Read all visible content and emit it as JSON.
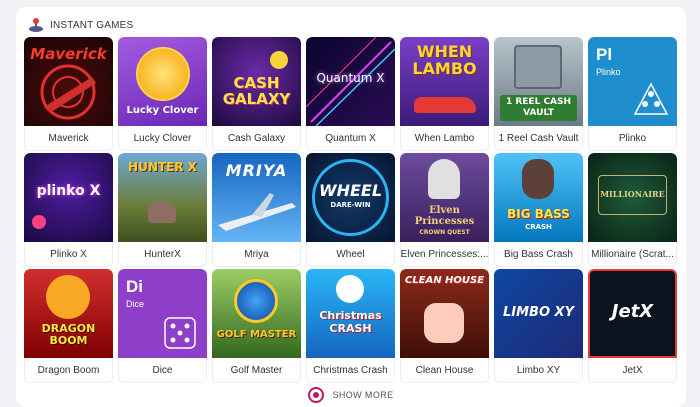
{
  "section": {
    "title": "INSTANT GAMES",
    "icon": "joystick-icon"
  },
  "games": [
    {
      "name": "Maverick",
      "art": "Maverick"
    },
    {
      "name": "Lucky Clover",
      "art": "Lucky Clover"
    },
    {
      "name": "Cash Galaxy",
      "art": "CASH GALAXY"
    },
    {
      "name": "Quantum X",
      "art": "Quantum X"
    },
    {
      "name": "When Lambo",
      "art": "WHEN LAMBO"
    },
    {
      "name": "1 Reel Cash Vault",
      "art": "1 REEL CASH VAULT"
    },
    {
      "name": "Plinko",
      "art": "Pl",
      "art2": "Plinko"
    },
    {
      "name": "Plinko X",
      "art": "plinko X"
    },
    {
      "name": "HunterX",
      "art": "HUNTER X"
    },
    {
      "name": "Mriya",
      "art": "MRIYA"
    },
    {
      "name": "Wheel",
      "art": "WHEEL",
      "art2": "DARE-WIN"
    },
    {
      "name": "Elven Princesses:...",
      "art": "Elven Princesses",
      "art2": "CROWN QUEST"
    },
    {
      "name": "Big Bass Crash",
      "art": "BIG BASS",
      "art2": "CRASH"
    },
    {
      "name": "Millionaire (Scrat...",
      "art": "MILLIONAIRE"
    },
    {
      "name": "Dragon Boom",
      "art": "DRAGON BOOM"
    },
    {
      "name": "Dice",
      "art": "Di",
      "art2": "Dice"
    },
    {
      "name": "Golf Master",
      "art": "GOLF MASTER"
    },
    {
      "name": "Christmas Crash",
      "art": "Christmas CRASH"
    },
    {
      "name": "Clean House",
      "art": "CLEAN HOUSE"
    },
    {
      "name": "Limbo XY",
      "art": "LIMBO XY"
    },
    {
      "name": "JetX",
      "art": "JetX"
    }
  ],
  "footer": {
    "show_more": "SHOW MORE",
    "icon": "casino-chip-icon"
  },
  "colors": {
    "accent": "#c2185b",
    "plinko": "#1f8ecf",
    "dice": "#8e3fc9"
  }
}
